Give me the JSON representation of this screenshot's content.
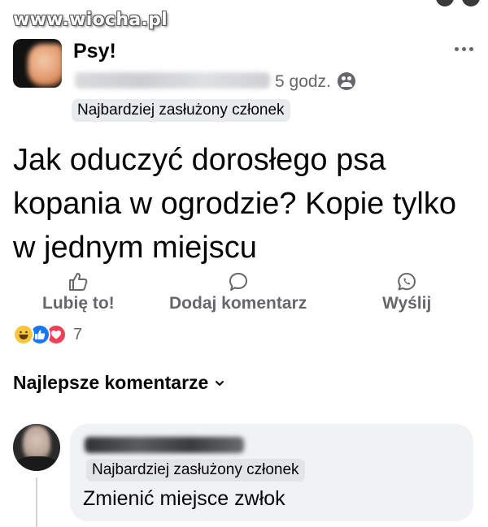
{
  "watermark": "www.wiocha.pl",
  "post": {
    "group_name": "Psy!",
    "time": "5 godz. ·",
    "badge": "Najbardziej zasłużony członek",
    "text": "Jak oduczyć dorosłego psa kopania w ogrodzie? Kopie tylko w jednym miejscu",
    "audience_icon": "group-audience-icon",
    "actions": {
      "like": "Lubię to!",
      "comment": "Dodaj komentarz",
      "share": "Wyślij"
    },
    "reaction_count": "7",
    "reactions": [
      "haha",
      "like",
      "love"
    ]
  },
  "comments": {
    "filter_label": "Najlepsze komentarze",
    "items": [
      {
        "badge": "Najbardziej zasłużony członek",
        "text": "Zmienić miejsce zwłok"
      }
    ]
  },
  "colors": {
    "text_primary": "#050505",
    "text_secondary": "#65676b",
    "badge_bg": "#e8eaed",
    "bubble_bg": "#f0f2f5",
    "like_blue": "#1877f2",
    "love_red": "#f33e58",
    "haha_yellow": "#f7c540"
  }
}
